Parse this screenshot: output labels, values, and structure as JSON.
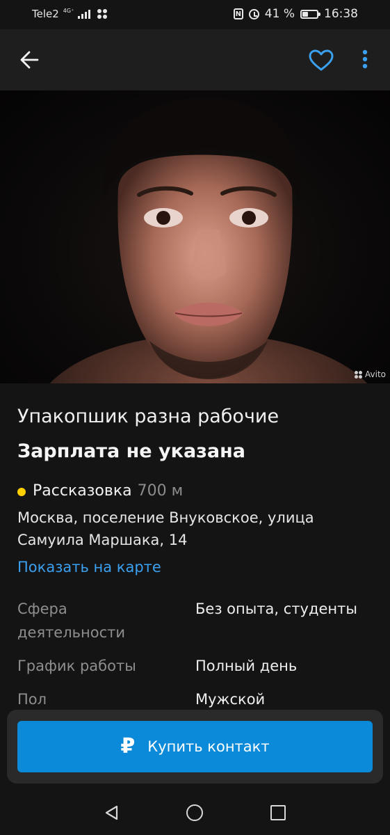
{
  "status_bar": {
    "carrier": "Tele2",
    "network": "4G⁺",
    "battery_percent": "41 %",
    "battery_level": 0.41,
    "time": "16:38"
  },
  "app_bar": {
    "back_icon": "arrow-left-icon",
    "favorite_icon": "heart-outline-icon",
    "more_icon": "more-vertical-icon",
    "accent_color": "#3aa0ef"
  },
  "photo": {
    "watermark": "Avito"
  },
  "listing": {
    "title": "Упакопшик разна рабочие",
    "salary": "Зарплата не указана",
    "metro_station": "Рассказовка",
    "metro_color": "#ffd000",
    "metro_distance": "700 м",
    "address": "Москва, поселение Внуковское, улица Самуила Маршака, 14",
    "map_link": "Показать на карте"
  },
  "params": [
    {
      "key": "Сфера деятельности",
      "value": "Без опыта, студенты"
    },
    {
      "key": "График работы",
      "value": "Полный день"
    },
    {
      "key": "Пол",
      "value": "Мужской"
    }
  ],
  "buy_button": {
    "icon": "ruble-icon",
    "label": "Купить контакт",
    "color": "#0a8ad8"
  },
  "nav_bar": {
    "back": "triangle-back-icon",
    "home": "circle-home-icon",
    "recents": "square-recents-icon"
  }
}
